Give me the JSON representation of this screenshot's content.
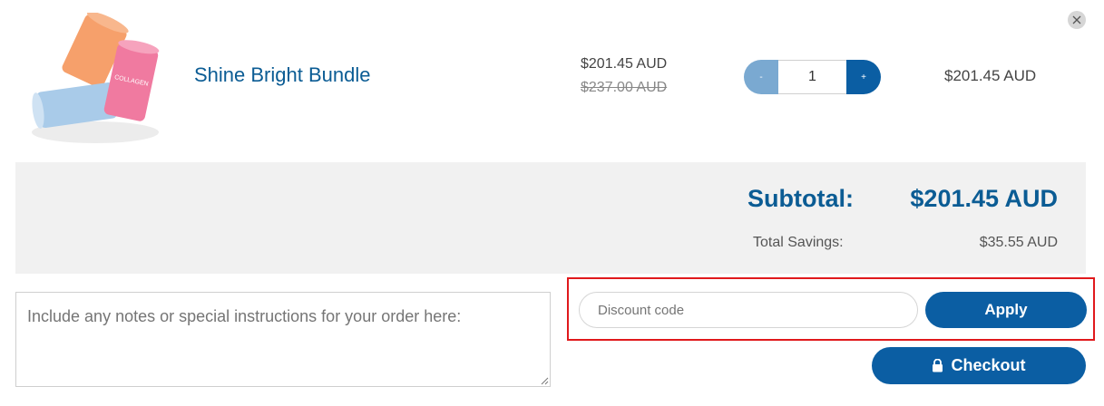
{
  "cart_item": {
    "title": "Shine Bright Bundle",
    "price": "$201.45 AUD",
    "compare_price": "$237.00 AUD",
    "quantity": "1",
    "minus_label": "-",
    "plus_label": "+",
    "line_total": "$201.45 AUD",
    "image_label": "COLLAGEN"
  },
  "summary": {
    "subtotal_label": "Subtotal:",
    "subtotal_value": "$201.45 AUD",
    "savings_label": "Total Savings:",
    "savings_value": "$35.55 AUD"
  },
  "notes": {
    "placeholder": "Include any notes or special instructions for your order here:"
  },
  "discount": {
    "placeholder": "Discount code",
    "apply_label": "Apply"
  },
  "checkout": {
    "label": "Checkout"
  },
  "colors": {
    "brand_blue": "#0b5ea3",
    "light_blue": "#7aa9d1",
    "highlight_red": "#e0191c"
  }
}
